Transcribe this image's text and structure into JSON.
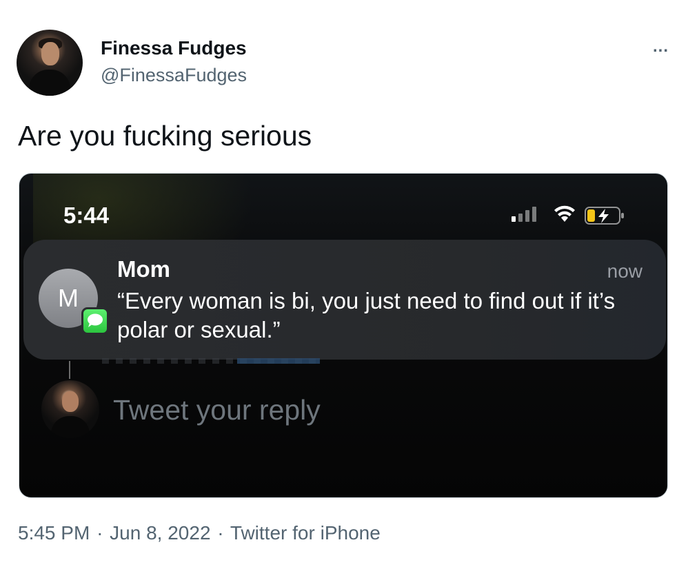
{
  "author": {
    "name": "Finessa Fudges",
    "handle": "@FinessaFudges"
  },
  "more_icon": "...",
  "tweet_text": "Are you fucking serious",
  "screenshot": {
    "clock": "5:44",
    "notification": {
      "app_icon": "messages-icon",
      "avatar_initial": "M",
      "title": "Mom",
      "time": "now",
      "body": "“Every woman is bi, you just need to find out if it’s polar or sexual.”"
    },
    "reply_placeholder": "Tweet your reply",
    "colors": {
      "notification_bg": "#2a2c2f",
      "badge_green": "#34c759",
      "battery_yellow": "#f5c518"
    }
  },
  "meta": {
    "time": "5:45 PM",
    "date": "Jun 8, 2022",
    "source": "Twitter for iPhone",
    "separator": "·"
  }
}
